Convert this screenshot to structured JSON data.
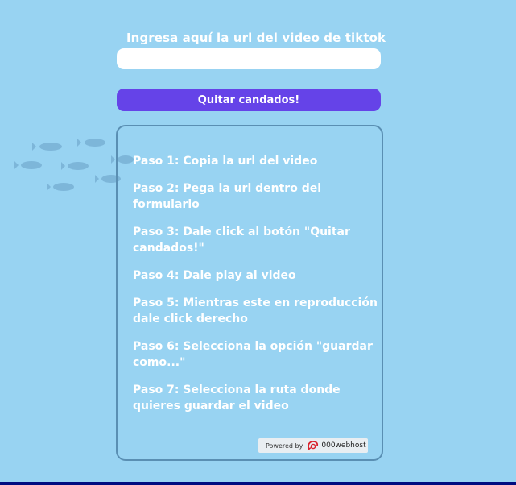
{
  "form": {
    "url_label": "Ingresa aquí la url del video de tiktok",
    "url_input_value": "",
    "url_input_placeholder": "",
    "submit_label": "Quitar candados!"
  },
  "steps": [
    "Paso 1: Copia la url del video",
    "Paso 2: Pega la url dentro del formulario",
    "Paso 3: Dale click al botón \"Quitar candados!\"",
    "Paso 4: Dale play al video",
    "Paso 5: Mientras este en reproducción dale click derecho",
    "Paso 6: Selecciona la opción \"guardar como...\"",
    "Paso 7: Selecciona la ruta donde quieres guardar el video"
  ],
  "footer": {
    "powered_by": "Powered by",
    "host_name": "000webhost",
    "host_logo_icon": "000webhost-logo-icon"
  },
  "colors": {
    "background": "#98d3f2",
    "button": "#6543e8",
    "box_border": "#5a8fb3",
    "fish": "#7db6d9",
    "bottom_bar": "#000c80",
    "text": "#ffffff"
  }
}
